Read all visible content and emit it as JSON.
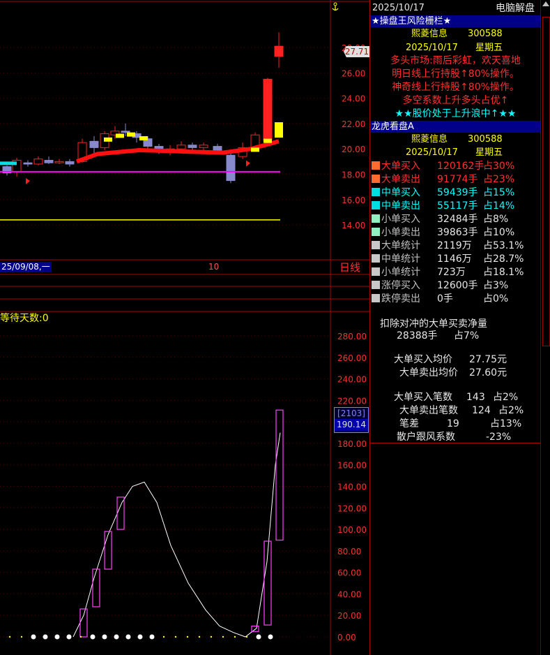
{
  "chart": {
    "price_axis": [
      "28.00",
      "26.00",
      "24.00",
      "22.00",
      "20.00",
      "18.00",
      "16.00",
      "14.00"
    ],
    "last_price": "27.71",
    "date_axis_left": "25/09/08,一",
    "date_axis_mid": "10",
    "period_label": "日线",
    "indicator_label": "等待天数:0",
    "ind_axis": [
      "280.00",
      "260.00",
      "240.00",
      "220.00",
      "200.00",
      "180.00",
      "160.00",
      "140.00",
      "120.00",
      "100.00",
      "80.00",
      "60.00",
      "40.00",
      "20.00",
      "0.00"
    ],
    "ind_box_top": "[2103]",
    "ind_box_val": "190.14",
    "colors": {
      "up": "#ff2020",
      "down": "#8888cc",
      "ma": "#ff00ff",
      "yellow": "#ffff00"
    }
  },
  "panel": {
    "date": "2025/10/17",
    "title": "电脑解盘",
    "sec1_header": "★操盘王风险栅栏★",
    "stock_name": "熙菱信息",
    "stock_code": "300588",
    "trade_date": "2025/10/17",
    "weekday": "星期五",
    "msg1": "多头市场:雨后彩虹，欢天喜地",
    "msg2": "明日线上行持股↑80%操作。",
    "msg3": "神奇线上行持股↑80%操作。",
    "msg4": "多空系数上升多头占优↑",
    "msg5": "★★股价处于上升浪中↑★★",
    "sec2_header": "龙虎看盘A",
    "rows": [
      {
        "label": "大单买入",
        "v1": "120162手",
        "v2": "占30%",
        "color": "#ff6a30",
        "tcolor": "#ff3030"
      },
      {
        "label": "大单卖出",
        "v1": "91774手",
        "v2": "占23%",
        "color": "#ff6a30",
        "tcolor": "#ff3030"
      },
      {
        "label": "中单买入",
        "v1": "59439手",
        "v2": "占15%",
        "color": "#00e0e0",
        "tcolor": "#00ffff"
      },
      {
        "label": "中单卖出",
        "v1": "55117手",
        "v2": "占14%",
        "color": "#00e0e0",
        "tcolor": "#00ffff"
      },
      {
        "label": "小单买入",
        "v1": "32484手",
        "v2": "占8%",
        "color": "#90f0c0",
        "tcolor": "#c0c0c0"
      },
      {
        "label": "小单卖出",
        "v1": "39863手",
        "v2": "占10%",
        "color": "#90f0c0",
        "tcolor": "#c0c0c0"
      },
      {
        "label": "大单统计",
        "v1": "2119万",
        "v2": "占53.1%",
        "color": "#c8c8c8",
        "tcolor": "#c0c0c0"
      },
      {
        "label": "中单统计",
        "v1": "1146万",
        "v2": "占28.7%",
        "color": "#c8c8c8",
        "tcolor": "#c0c0c0"
      },
      {
        "label": "小单统计",
        "v1": "723万",
        "v2": "占18.1%",
        "color": "#c8c8c8",
        "tcolor": "#c0c0c0"
      },
      {
        "label": "涨停买入",
        "v1": "12600手",
        "v2": "占3%",
        "color": "#c8c8c8",
        "tcolor": "#c0c0c0"
      },
      {
        "label": "跌停卖出",
        "v1": "0手",
        "v2": "占0%",
        "color": "#c8c8c8",
        "tcolor": "#c0c0c0"
      }
    ],
    "net_label": "扣除对冲的大单买卖净量",
    "net_value": "28388手",
    "net_pct": "占7%",
    "avg_buy_label": "大单买入均价",
    "avg_buy": "27.75元",
    "avg_sell_label": "大单卖出均价",
    "avg_sell": "27.60元",
    "cnt_buy_label": "大单买入笔数",
    "cnt_buy": "143",
    "cnt_buy_pct": "占2%",
    "cnt_sell_label": "大单卖出笔数",
    "cnt_sell": "124",
    "cnt_sell_pct": "占2%",
    "diff_label": "笔差",
    "diff_value": "19",
    "diff_pct": "占13%",
    "retail_label": "散户跟风系数",
    "retail_value": "-23%"
  }
}
